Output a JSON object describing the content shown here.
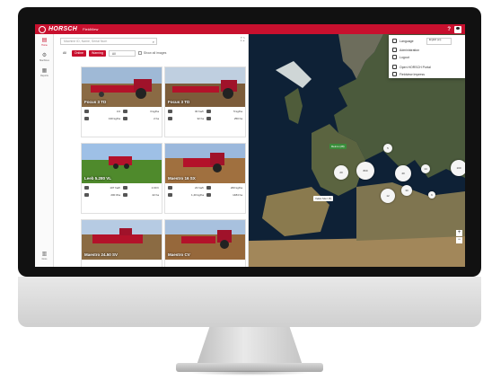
{
  "app": {
    "brand": "HORSCH",
    "name": "FieldView",
    "help_label": "?"
  },
  "nav": {
    "items": [
      {
        "id": "home",
        "label": "Home",
        "glyph": "▤"
      },
      {
        "id": "machines",
        "label": "Machines",
        "glyph": "⚙"
      },
      {
        "id": "reports",
        "label": "Reports",
        "glyph": "▦"
      }
    ],
    "bottom": {
      "label": "Docs",
      "glyph": "▥"
    }
  },
  "list": {
    "search_placeholder": "Machine ID, Name, Serial Num",
    "filters": {
      "all": "All",
      "online": "Online",
      "warning": "Warning",
      "select_value": "All",
      "checkbox_label": "Show all images"
    }
  },
  "cards": [
    {
      "name": "Focus 3 TD",
      "stats": [
        [
          "Area",
          "3.0"
        ],
        [
          "Fuel",
          "3 kg/ha"
        ],
        [
          "Rate",
          "130 kg/ha"
        ],
        [
          "Speed",
          "2 ha"
        ]
      ]
    },
    {
      "name": "Focus 3 TD",
      "stats": [
        [
          "Area",
          "30 ha/h"
        ],
        [
          "Fuel",
          "5 kg/ha"
        ],
        [
          "Rate",
          "32 ha"
        ],
        [
          "Speed",
          "250 ha"
        ]
      ]
    },
    {
      "name": "Leeb 5.280 VL",
      "stats": [
        [
          "Area",
          "107 ha/h"
        ],
        [
          "Fuel",
          "1:00 h"
        ],
        [
          "Rate",
          "200 l/ha"
        ],
        [
          "Speed",
          "22 ha"
        ]
      ]
    },
    {
      "name": "Maestro 16 SX",
      "stats": [
        [
          "Area",
          "23 ha/h"
        ],
        [
          "Fuel",
          "260 kg/ha"
        ],
        [
          "Rate",
          "1,40 kg/ha"
        ],
        [
          "Speed",
          "1484 ha"
        ]
      ]
    },
    {
      "name": "Maestro 24.50 SV",
      "stats": []
    },
    {
      "name": "Maestro CV",
      "stats": []
    }
  ],
  "map": {
    "labels": [
      {
        "text": "Reims (28)",
        "color": "#3a8c3a"
      },
      {
        "text": "Velké Mez (5)",
        "color": "#ffffff"
      }
    ],
    "clusters": [
      {
        "count": "5"
      },
      {
        "count": "20"
      },
      {
        "count": "800"
      },
      {
        "count": "40"
      },
      {
        "count": "14"
      },
      {
        "count": "100"
      },
      {
        "count": "6"
      },
      {
        "count": "12"
      },
      {
        "count": "30"
      }
    ],
    "zoom_in": "+",
    "zoom_out": "−"
  },
  "user_menu": {
    "language_label": "Language",
    "language_value": "English (en)",
    "administration": "Administration",
    "logout": "Logout",
    "open_portal": "Open HORSCH Portal",
    "help_link": "Fieldview Impress"
  }
}
